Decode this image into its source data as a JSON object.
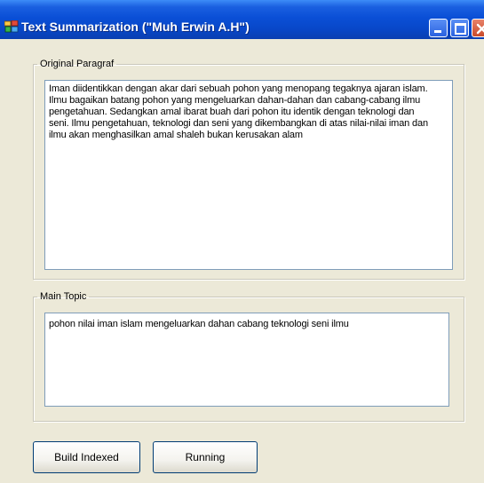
{
  "window": {
    "title": "Text Summarization (\"Muh Erwin A.H\")",
    "icon": "app-icon"
  },
  "original_group": {
    "label": "Original Paragraf",
    "text": "Iman diidentikkan dengan akar dari sebuah pohon yang menopang tegaknya ajaran islam.\nIlmu bagaikan batang pohon yang mengeluarkan dahan-dahan dan cabang-cabang ilmu\npengetahuan. Sedangkan amal ibarat buah dari pohon itu identik dengan teknologi dan\nseni. Ilmu pengetahuan, teknologi dan seni yang dikembangkan di atas nilai-nilai iman dan\nilmu akan menghasilkan amal shaleh bukan kerusakan alam"
  },
  "topic_group": {
    "label": "Main Topic",
    "text": "pohon nilai iman islam mengeluarkan dahan cabang teknologi seni ilmu"
  },
  "buttons": {
    "build_indexed": "Build Indexed",
    "running": "Running"
  },
  "colors": {
    "titlebar": "#0a4fd6",
    "window_bg": "#ece9d8",
    "textbox_border": "#7f9db9",
    "close_button": "#c84a2a"
  }
}
